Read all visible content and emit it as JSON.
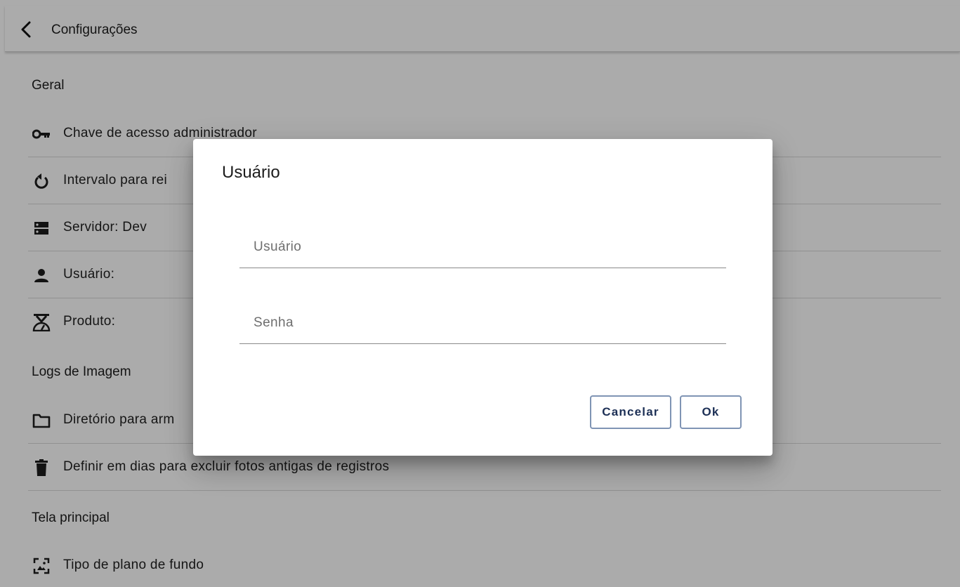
{
  "appbar": {
    "title": "Configurações",
    "back_icon": "chevron-left-icon"
  },
  "sections": [
    {
      "header": "Geral",
      "items": [
        {
          "icon": "key-icon",
          "label": "Chave de acesso administrador"
        },
        {
          "icon": "restart-icon",
          "label": "Intervalo para rei"
        },
        {
          "icon": "server-icon",
          "label": "Servidor: Dev"
        },
        {
          "icon": "person-icon",
          "label": "Usuário:"
        },
        {
          "icon": "scale-icon",
          "label": "Produto:"
        }
      ]
    },
    {
      "header": "Logs de Imagem",
      "items": [
        {
          "icon": "folder-icon",
          "label": "Diretório para arm"
        },
        {
          "icon": "trash-icon",
          "label": "Definir em dias para excluir fotos antigas de registros"
        }
      ]
    },
    {
      "header": "Tela principal",
      "items": [
        {
          "icon": "wallpaper-icon",
          "label": "Tipo de plano de fundo"
        }
      ]
    }
  ],
  "dialog": {
    "title": "Usuário",
    "user_field": {
      "placeholder": "Usuário",
      "value": ""
    },
    "password_field": {
      "placeholder": "Senha",
      "value": ""
    },
    "cancel_label": "Cancelar",
    "ok_label": "Ok"
  },
  "colors": {
    "scrim": "#000000",
    "button_border": "#7f94b4",
    "button_text": "#1c2f55"
  }
}
